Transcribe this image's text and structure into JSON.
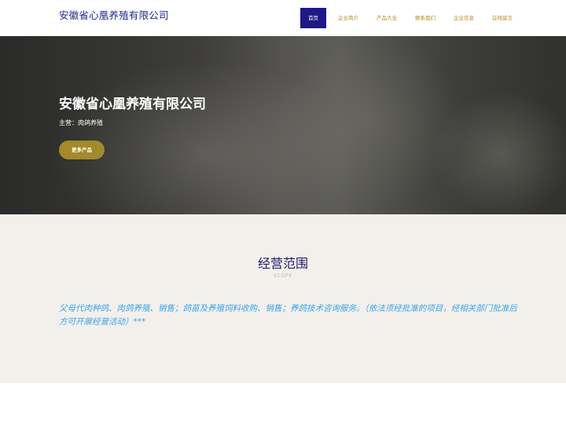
{
  "header": {
    "company_name": "安徽省心凰养殖有限公司",
    "nav": [
      {
        "label": "首页",
        "active": true
      },
      {
        "label": "企业简介",
        "active": false
      },
      {
        "label": "产品大全",
        "active": false
      },
      {
        "label": "联系我们",
        "active": false
      },
      {
        "label": "企业信息",
        "active": false
      },
      {
        "label": "在线留言",
        "active": false
      }
    ]
  },
  "hero": {
    "title": "安徽省心凰养殖有限公司",
    "subtitle": "主营：肉鸽养殖",
    "button_label": "更多产品"
  },
  "scope": {
    "title": "经营范围",
    "subtitle": "SCOPE",
    "text": "父母代肉种鸽、肉鸽养殖、销售；鸽苗及养殖饲料收购、销售；养鸽技术咨询服务。（依法须经批准的项目，经相关部门批准后方可开展经营活动）***"
  },
  "colors": {
    "nav_active_bg": "#1e1a86",
    "nav_text": "#b08a1e",
    "button_bg": "#a38a2a",
    "scope_bg": "#f3f0ec",
    "scope_text": "#3aa4e6"
  }
}
